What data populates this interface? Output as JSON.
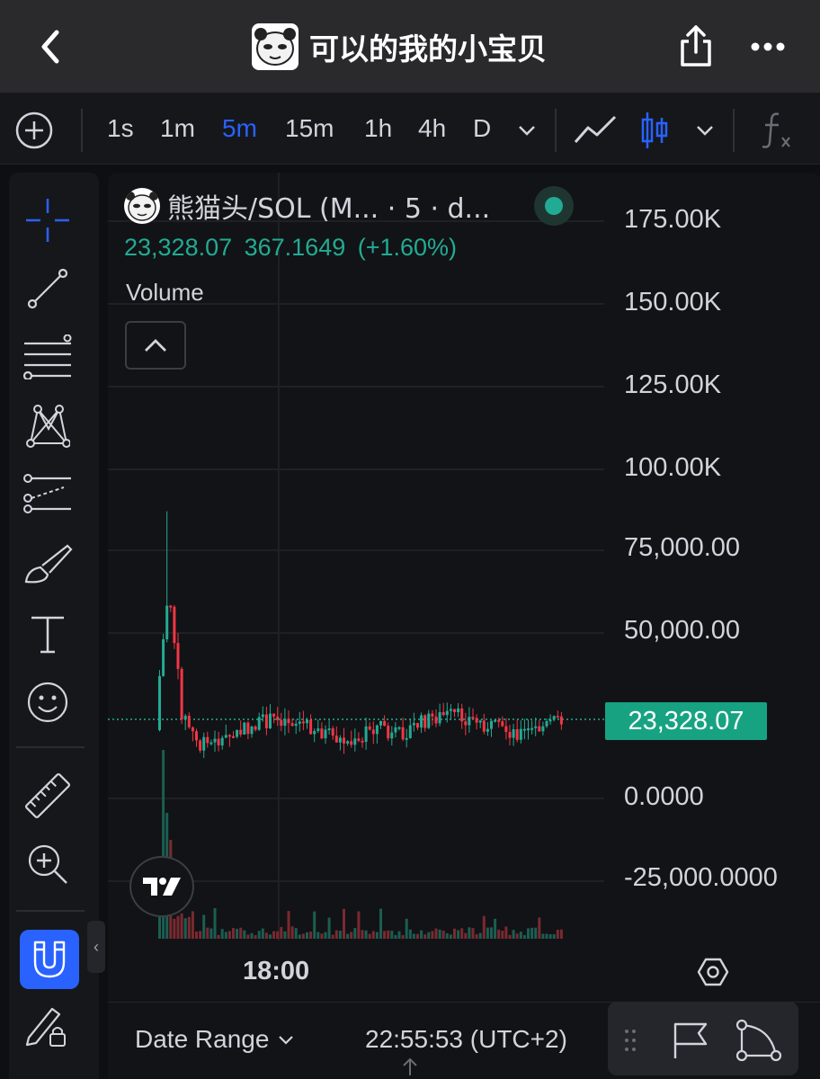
{
  "header": {
    "title": "可以的我的小宝贝",
    "back_icon": "chevron-left-icon",
    "share_icon": "share-icon",
    "more_icon": "more-dots-icon"
  },
  "toolbar": {
    "intervals": [
      "1s",
      "1m",
      "5m",
      "15m",
      "1h",
      "4h",
      "D"
    ],
    "active_interval": "5m",
    "accent_color": "#2962ff"
  },
  "legend": {
    "symbol": "熊猫头/SOL (M... · 5 · d...",
    "price_line": "23,328.07  367.1649 (+1.60%)",
    "up_color": "#22ab94",
    "down_color": "#f23645"
  },
  "volume_pane": {
    "label": "Volume"
  },
  "price_axis": {
    "labels": [
      "175.00K",
      "150.00K",
      "125.00K",
      "100.00K",
      "75,000.00",
      "50,000.00",
      "0.0000",
      "-25,000.0000"
    ],
    "last_price": "23,328.07"
  },
  "time_axis": {
    "labels": [
      "18:00"
    ]
  },
  "bottom": {
    "date_range_label": "Date Range",
    "clock": "22:55:53 (UTC+2)"
  }
}
